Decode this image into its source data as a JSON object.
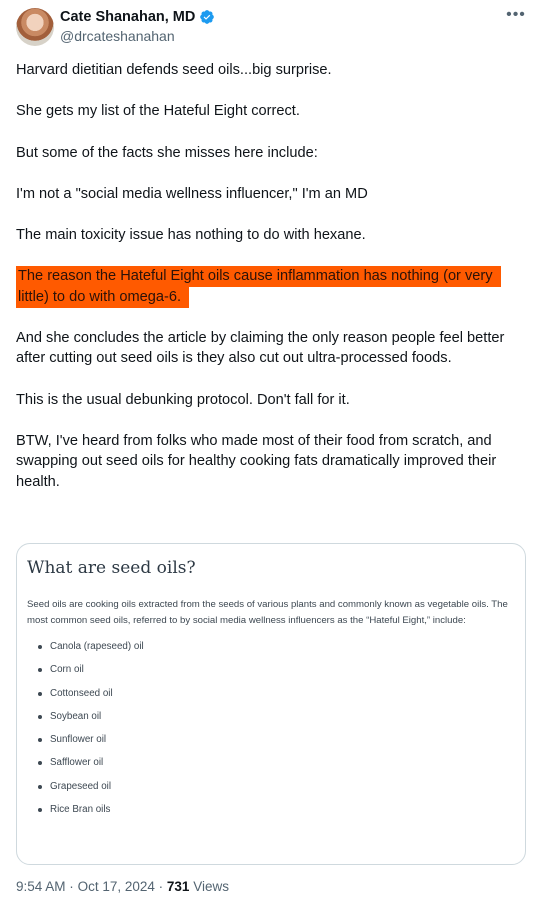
{
  "author": {
    "display_name": "Cate Shanahan, MD",
    "handle": "@drcateshanahan",
    "verified": true
  },
  "tweet": {
    "paragraphs": [
      "Harvard dietitian defends seed oils...big surprise.",
      "She gets my list of the Hateful Eight correct.",
      "But some of the facts she misses here include:",
      "I'm not a \"social media wellness influencer,\" I'm an MD",
      "The main toxicity issue has nothing to do with hexane.",
      "The reason the Hateful Eight oils cause inflammation has nothing (or very little) to do with omega-6.",
      "And she concludes the article by claiming the only reason people feel better after cutting out seed oils is they also cut out ultra-processed foods.",
      "This is the usual debunking protocol. Don't fall for it.",
      "BTW, I've heard from folks who made most of their food from scratch, and swapping out seed oils for healthy cooking fats dramatically improved their health."
    ],
    "highlight_color": "#ff5a00"
  },
  "card": {
    "title": "What are seed oils?",
    "intro": "Seed oils are cooking oils extracted from the seeds of various plants and commonly known as vegetable oils. The most common seed oils, referred to by social media wellness influencers as the “Hateful Eight,” include:",
    "items": [
      "Canola (rapeseed) oil",
      "Corn oil",
      "Cottonseed oil",
      "Soybean oil",
      "Sunflower oil",
      "Safflower oil",
      "Grapeseed oil",
      "Rice Bran oils"
    ]
  },
  "meta": {
    "time": "9:54 AM",
    "date": "Oct 17, 2024",
    "separator": "·",
    "views_count": "731",
    "views_label": "Views"
  },
  "icons": {
    "more": "more-options-icon",
    "verified": "verified-badge-icon"
  },
  "colors": {
    "verified": "#1d9bf0",
    "text": "#0f1419",
    "secondary": "#536471"
  }
}
